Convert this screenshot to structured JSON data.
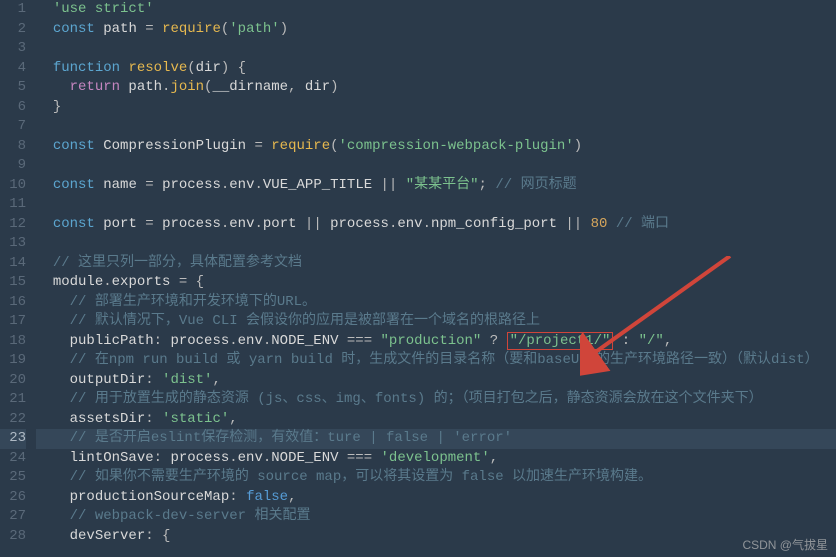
{
  "lines": [
    {
      "n": 1,
      "segs": [
        [
          "str",
          "'use strict'"
        ]
      ],
      "indent": 1
    },
    {
      "n": 2,
      "segs": [
        [
          "kw",
          "const "
        ],
        [
          "id",
          "path"
        ],
        [
          "punc",
          " = "
        ],
        [
          "fn",
          "require"
        ],
        [
          "punc",
          "("
        ],
        [
          "str",
          "'path'"
        ],
        [
          "punc",
          ")"
        ]
      ],
      "indent": 1
    },
    {
      "n": 3,
      "segs": [],
      "indent": 1
    },
    {
      "n": 4,
      "segs": [
        [
          "kw",
          "function "
        ],
        [
          "fn",
          "resolve"
        ],
        [
          "punc",
          "("
        ],
        [
          "id",
          "dir"
        ],
        [
          "punc",
          ") {"
        ]
      ],
      "indent": 1
    },
    {
      "n": 5,
      "segs": [
        [
          "ret",
          "return "
        ],
        [
          "id",
          "path"
        ],
        [
          "punc",
          "."
        ],
        [
          "fn",
          "join"
        ],
        [
          "punc",
          "("
        ],
        [
          "id",
          "__dirname"
        ],
        [
          "punc",
          ", "
        ],
        [
          "id",
          "dir"
        ],
        [
          "punc",
          ")"
        ]
      ],
      "indent": 2
    },
    {
      "n": 6,
      "segs": [
        [
          "punc",
          "}"
        ]
      ],
      "indent": 1
    },
    {
      "n": 7,
      "segs": [],
      "indent": 1
    },
    {
      "n": 8,
      "segs": [
        [
          "kw",
          "const "
        ],
        [
          "id",
          "CompressionPlugin"
        ],
        [
          "punc",
          " = "
        ],
        [
          "fn",
          "require"
        ],
        [
          "punc",
          "("
        ],
        [
          "str",
          "'compression-webpack-plugin'"
        ],
        [
          "punc",
          ")"
        ]
      ],
      "indent": 1
    },
    {
      "n": 9,
      "segs": [],
      "indent": 1
    },
    {
      "n": 10,
      "segs": [
        [
          "kw",
          "const "
        ],
        [
          "id",
          "name"
        ],
        [
          "punc",
          " = "
        ],
        [
          "id",
          "process"
        ],
        [
          "punc",
          "."
        ],
        [
          "id",
          "env"
        ],
        [
          "punc",
          "."
        ],
        [
          "id",
          "VUE_APP_TITLE"
        ],
        [
          "punc",
          " || "
        ],
        [
          "str",
          "\"某某平台\""
        ],
        [
          "punc",
          "; "
        ],
        [
          "cm",
          "// 网页标题"
        ]
      ],
      "indent": 1
    },
    {
      "n": 11,
      "segs": [],
      "indent": 1
    },
    {
      "n": 12,
      "segs": [
        [
          "kw",
          "const "
        ],
        [
          "id",
          "port"
        ],
        [
          "punc",
          " = "
        ],
        [
          "id",
          "process"
        ],
        [
          "punc",
          "."
        ],
        [
          "id",
          "env"
        ],
        [
          "punc",
          "."
        ],
        [
          "id",
          "port"
        ],
        [
          "punc",
          " || "
        ],
        [
          "id",
          "process"
        ],
        [
          "punc",
          "."
        ],
        [
          "id",
          "env"
        ],
        [
          "punc",
          "."
        ],
        [
          "id",
          "npm_config_port"
        ],
        [
          "punc",
          " || "
        ],
        [
          "num",
          "80"
        ],
        [
          "punc",
          " "
        ],
        [
          "cm",
          "// 端口"
        ]
      ],
      "indent": 1
    },
    {
      "n": 13,
      "segs": [],
      "indent": 1
    },
    {
      "n": 14,
      "segs": [
        [
          "cm",
          "// 这里只列一部分，具体配置参考文档"
        ]
      ],
      "indent": 1
    },
    {
      "n": 15,
      "segs": [
        [
          "id",
          "module"
        ],
        [
          "punc",
          "."
        ],
        [
          "id",
          "exports"
        ],
        [
          "punc",
          " = {"
        ]
      ],
      "indent": 1
    },
    {
      "n": 16,
      "segs": [
        [
          "cm",
          "// 部署生产环境和开发环境下的URL。"
        ]
      ],
      "indent": 2
    },
    {
      "n": 17,
      "segs": [
        [
          "cm",
          "// 默认情况下，Vue CLI 会假设你的应用是被部署在一个域名的根路径上"
        ]
      ],
      "indent": 2
    },
    {
      "n": 18,
      "segs": [
        [
          "id",
          "publicPath"
        ],
        [
          "punc",
          ": "
        ],
        [
          "id",
          "process"
        ],
        [
          "punc",
          "."
        ],
        [
          "id",
          "env"
        ],
        [
          "punc",
          "."
        ],
        [
          "id",
          "NODE_ENV"
        ],
        [
          "punc",
          " === "
        ],
        [
          "str",
          "\"production\""
        ],
        [
          "punc",
          " ? "
        ],
        [
          "box",
          "\"/project1/\""
        ],
        [
          "punc",
          " : "
        ],
        [
          "str",
          "\"/\""
        ],
        [
          "punc",
          ","
        ]
      ],
      "indent": 2
    },
    {
      "n": 19,
      "segs": [
        [
          "cm",
          "// 在npm run build 或 yarn build 时，生成文件的目录名称（要和baseUrl的生产环境路径一致）（默认dist）"
        ]
      ],
      "indent": 2
    },
    {
      "n": 20,
      "segs": [
        [
          "id",
          "outputDir"
        ],
        [
          "punc",
          ": "
        ],
        [
          "str",
          "'dist'"
        ],
        [
          "punc",
          ","
        ]
      ],
      "indent": 2
    },
    {
      "n": 21,
      "segs": [
        [
          "cm",
          "// 用于放置生成的静态资源 (js、css、img、fonts) 的；（项目打包之后，静态资源会放在这个文件夹下）"
        ]
      ],
      "indent": 2
    },
    {
      "n": 22,
      "segs": [
        [
          "id",
          "assetsDir"
        ],
        [
          "punc",
          ": "
        ],
        [
          "str",
          "'static'"
        ],
        [
          "punc",
          ","
        ]
      ],
      "indent": 2
    },
    {
      "n": 23,
      "segs": [
        [
          "cm",
          "// 是否开启eslint保存检测，有效值：ture | false | 'error'"
        ]
      ],
      "indent": 2,
      "hl": true
    },
    {
      "n": 24,
      "segs": [
        [
          "id",
          "lintOnSave"
        ],
        [
          "punc",
          ": "
        ],
        [
          "id",
          "process"
        ],
        [
          "punc",
          "."
        ],
        [
          "id",
          "env"
        ],
        [
          "punc",
          "."
        ],
        [
          "id",
          "NODE_ENV"
        ],
        [
          "punc",
          " === "
        ],
        [
          "str",
          "'development'"
        ],
        [
          "punc",
          ","
        ]
      ],
      "indent": 2
    },
    {
      "n": 25,
      "segs": [
        [
          "cm",
          "// 如果你不需要生产环境的 source map，可以将其设置为 false 以加速生产环境构建。"
        ]
      ],
      "indent": 2
    },
    {
      "n": 26,
      "segs": [
        [
          "id",
          "productionSourceMap"
        ],
        [
          "punc",
          ": "
        ],
        [
          "bool",
          "false"
        ],
        [
          "punc",
          ","
        ]
      ],
      "indent": 2
    },
    {
      "n": 27,
      "segs": [
        [
          "cm",
          "// webpack-dev-server 相关配置"
        ]
      ],
      "indent": 2
    },
    {
      "n": 28,
      "segs": [
        [
          "id",
          "devServer"
        ],
        [
          "punc",
          ": {"
        ]
      ],
      "indent": 2
    }
  ],
  "watermark": "CSDN @气拔星",
  "arrow_color": "#d0453a"
}
